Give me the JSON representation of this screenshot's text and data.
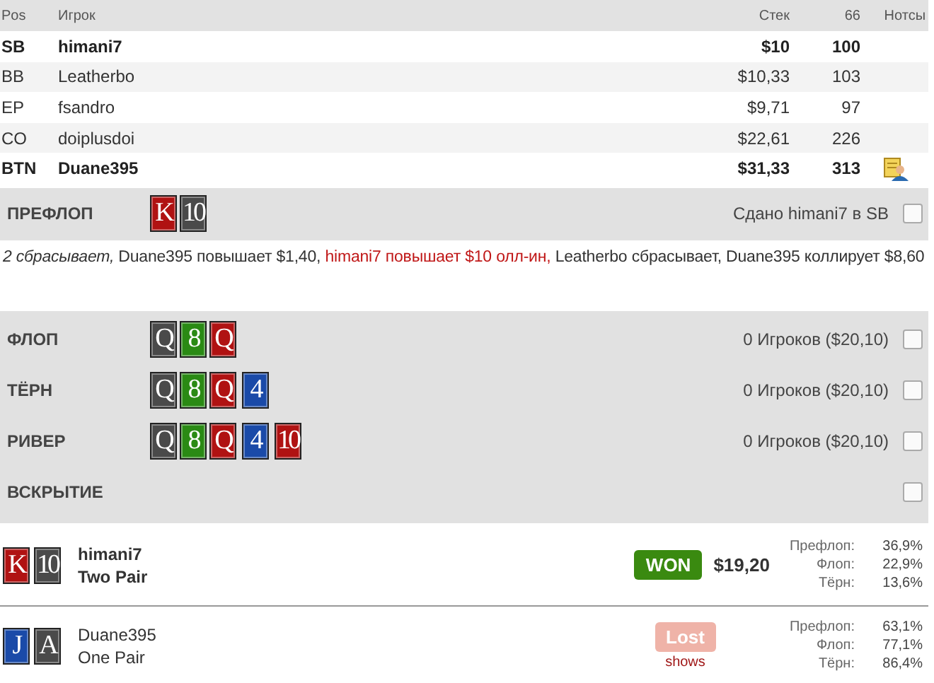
{
  "players_table": {
    "columns": [
      "Pos",
      "Игрок",
      "Стек",
      "66",
      "Нотсы"
    ],
    "rows": [
      {
        "pos": "SB",
        "name": "himani7",
        "stack": "$10",
        "bb": "100",
        "highlighted": true,
        "has_note": false
      },
      {
        "pos": "BB",
        "name": "Leatherbo",
        "stack": "$10,33",
        "bb": "103",
        "highlighted": false,
        "has_note": false
      },
      {
        "pos": "EP",
        "name": "fsandro",
        "stack": "$9,71",
        "bb": "97",
        "highlighted": false,
        "has_note": false
      },
      {
        "pos": "CO",
        "name": "doiplusdoi",
        "stack": "$22,61",
        "bb": "226",
        "highlighted": false,
        "has_note": false
      },
      {
        "pos": "BTN",
        "name": "Duane395",
        "stack": "$31,33",
        "bb": "313",
        "highlighted": true,
        "has_note": true
      }
    ]
  },
  "streets": [
    {
      "label": "ПРЕФЛОП",
      "cards": [
        {
          "rank": "K",
          "color": "#b01212"
        },
        {
          "rank": "10",
          "color": "#4a4a4a"
        }
      ],
      "info": "Сдано himani7 в SB",
      "checked": false,
      "actions": [
        {
          "kind": "folded",
          "text": "2 сбрасывает,"
        },
        {
          "kind": "normal",
          "text": " Duane395 повышает $1,40, "
        },
        {
          "kind": "hero",
          "text": "himani7 повышает $10 олл-ин,"
        },
        {
          "kind": "normal",
          "text": " Leatherbo сбрасывает, Duane395 коллирует $8,60"
        }
      ]
    },
    {
      "label": "ФЛОП",
      "cards": [
        {
          "rank": "Q",
          "color": "#4a4a4a"
        },
        {
          "rank": "8",
          "color": "#2a8a14"
        },
        {
          "rank": "Q",
          "color": "#b01212"
        }
      ],
      "info": "0 Игроков ($20,10)",
      "checked": false
    },
    {
      "label": "ТЁРН",
      "cards": [
        {
          "rank": "Q",
          "color": "#4a4a4a"
        },
        {
          "rank": "8",
          "color": "#2a8a14"
        },
        {
          "rank": "Q",
          "color": "#b01212"
        },
        {
          "rank": "4",
          "color": "#1a4aa8"
        }
      ],
      "info": "0 Игроков ($20,10)",
      "checked": false
    },
    {
      "label": "РИВЕР",
      "cards": [
        {
          "rank": "Q",
          "color": "#4a4a4a"
        },
        {
          "rank": "8",
          "color": "#2a8a14"
        },
        {
          "rank": "Q",
          "color": "#b01212"
        },
        {
          "rank": "4",
          "color": "#1a4aa8"
        },
        {
          "rank": "10",
          "color": "#b01212"
        }
      ],
      "info": "0 Игроков ($20,10)",
      "checked": false
    },
    {
      "label": "ВСКРЫТИЕ",
      "checked": false
    }
  ],
  "results": [
    {
      "cards": [
        {
          "rank": "K",
          "color": "#b01212"
        },
        {
          "rank": "10",
          "color": "#4a4a4a"
        }
      ],
      "name": "himani7",
      "hand": "Two Pair",
      "highlighted": true,
      "outcome": {
        "kind": "won",
        "label": "WON",
        "amount": "$19,20"
      },
      "equity": [
        {
          "label": "Префлоп:",
          "value": "36,9%"
        },
        {
          "label": "Флоп:",
          "value": "22,9%"
        },
        {
          "label": "Тёрн:",
          "value": "13,6%"
        }
      ]
    },
    {
      "cards": [
        {
          "rank": "J",
          "color": "#1a4aa8"
        },
        {
          "rank": "A",
          "color": "#4a4a4a"
        }
      ],
      "name": "Duane395",
      "hand": "One Pair",
      "highlighted": false,
      "outcome": {
        "kind": "lost",
        "label": "Lost",
        "note": "shows"
      },
      "equity": [
        {
          "label": "Префлоп:",
          "value": "63,1%"
        },
        {
          "label": "Флоп:",
          "value": "77,1%"
        },
        {
          "label": "Тёрн:",
          "value": "86,4%"
        }
      ]
    }
  ]
}
